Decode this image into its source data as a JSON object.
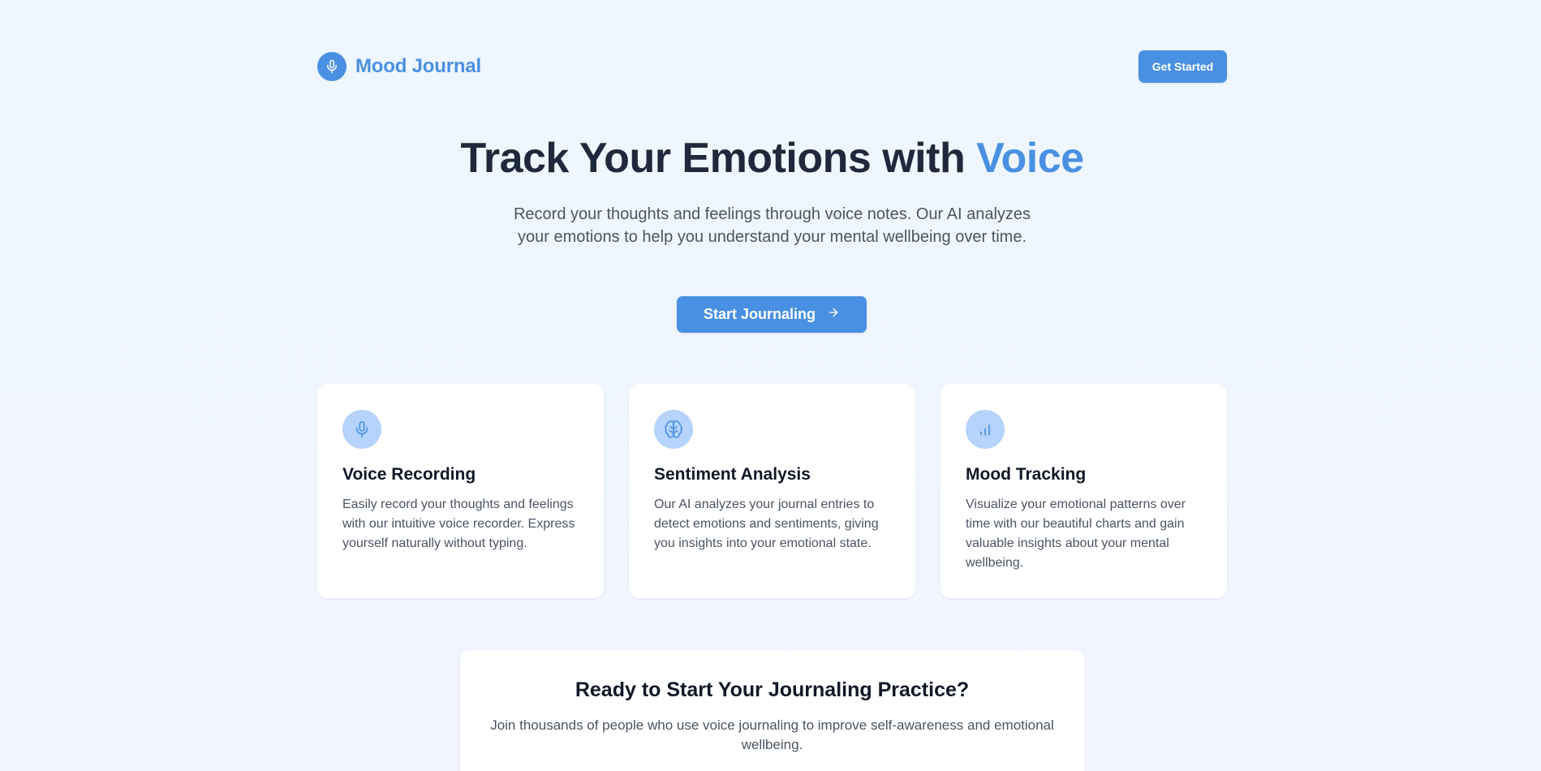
{
  "colors": {
    "accent": "#4a90e2",
    "icon_bg": "#b5d3fb",
    "page_bg": "#eef6ff"
  },
  "header": {
    "logo_icon": "microphone-icon",
    "logo_text": "Mood Journal",
    "get_started_label": "Get Started"
  },
  "hero": {
    "title_prefix": "Track Your Emotions with",
    "title_accent": "Voice",
    "subtitle": "Record your thoughts and feelings through voice notes. Our AI analyzes your emotions to help you understand your mental wellbeing over time.",
    "cta_label": "Start Journaling",
    "cta_icon": "arrow-right-icon"
  },
  "features": [
    {
      "icon": "microphone-icon",
      "title": "Voice Recording",
      "text": "Easily record your thoughts and feelings with our intuitive voice recorder. Express yourself naturally without typing."
    },
    {
      "icon": "brain-icon",
      "title": "Sentiment Analysis",
      "text": "Our AI analyzes your journal entries to detect emotions and sentiments, giving you insights into your emotional state."
    },
    {
      "icon": "bar-chart-icon",
      "title": "Mood Tracking",
      "text": "Visualize your emotional patterns over time with our beautiful charts and gain valuable insights about your mental wellbeing."
    }
  ],
  "ready": {
    "title": "Ready to Start Your Journaling Practice?",
    "text": "Join thousands of people who use voice journaling to improve self-awareness and emotional wellbeing."
  }
}
